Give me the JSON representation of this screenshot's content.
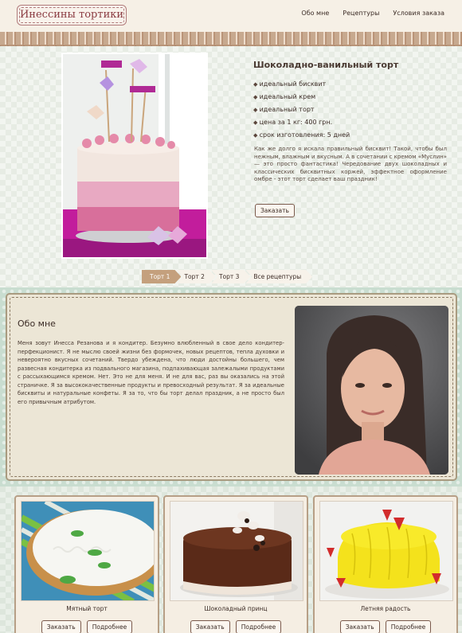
{
  "header": {
    "logo": "Инессины тортики",
    "nav": [
      "Обо мне",
      "Рецептуры",
      "Условия заказа"
    ]
  },
  "product": {
    "title": "Шоколадно-ванильный торт",
    "features": [
      "идеальный бисквит",
      "идеальный крем",
      "идеальный торт",
      "цена за 1 кг: 400 грн.",
      "срок изготовления: 5 дней"
    ],
    "description": "Как же долго я искала правильный бисквит! Такой, чтобы был нежным, влажным и вкусным. А в сочетании с кремом «Муслин» — это просто фантастика! Чередование двух шоколадных и классических бисквитных коржей, эффектное оформление омбре - этот торт сделает ваш праздник!",
    "order_label": "Заказать"
  },
  "tabs": [
    "Торт 1",
    "Торт 2",
    "Торт 3",
    "Все рецептуры"
  ],
  "about": {
    "title": "Обо мне",
    "text": "Меня зовут Инесса Резанова и я кондитер. Безумно влюбленный в свое дело кондитер-перфекционист. Я не мыслю своей жизни без формочек, новых рецептов, тепла духовки и невероятно вкусных сочетаний. Твердо убеждена, что люди достойны большего, чем развесная кондитерка из подвального магазина, подпахивающая залежалыми продуктами с рассыхающимся кремом. Нет. Это не для меня. И не для вас, раз вы оказались на этой страничке. Я за высококачественные продукты и превосходный результат. Я за идеальные бисквиты и натуральные конфеты. Я за то, что бы торт делал праздник, а не просто был его привычным атрибутом."
  },
  "cards": [
    {
      "name": "Мятный торт",
      "order": "Заказать",
      "more": "Подробнее"
    },
    {
      "name": "Шоколадный принц",
      "order": "Заказать",
      "more": "Подробнее"
    },
    {
      "name": "Летняя радость",
      "order": "Заказать",
      "more": "Подробнее"
    }
  ]
}
